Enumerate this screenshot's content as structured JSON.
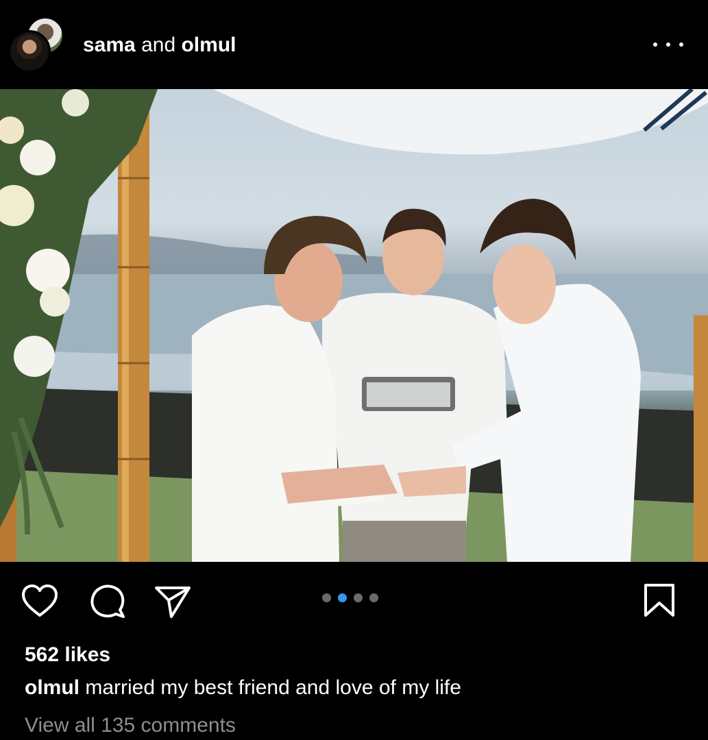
{
  "post": {
    "author_primary": "sama",
    "joiner": "and",
    "author_secondary": "olmul",
    "more_icon": "more-horizontal-icon"
  },
  "photo": {
    "description_icon": "wedding-photo",
    "carousel": {
      "count": 4,
      "active_index": 1
    }
  },
  "actions": {
    "like_icon": "heart-icon",
    "comment_icon": "comment-bubble-icon",
    "share_icon": "paper-plane-icon",
    "save_icon": "bookmark-icon"
  },
  "engagement": {
    "likes": "562 likes",
    "caption_user": "olmul",
    "caption_text": "married my best friend and love of my life",
    "view_comments": "View all 135 comments"
  },
  "colors": {
    "background": "#000000",
    "text": "#ffffff",
    "muted_text": "#8e8e8e",
    "carousel_active": "#3797f0",
    "carousel_inactive": "#6b6b6b"
  }
}
